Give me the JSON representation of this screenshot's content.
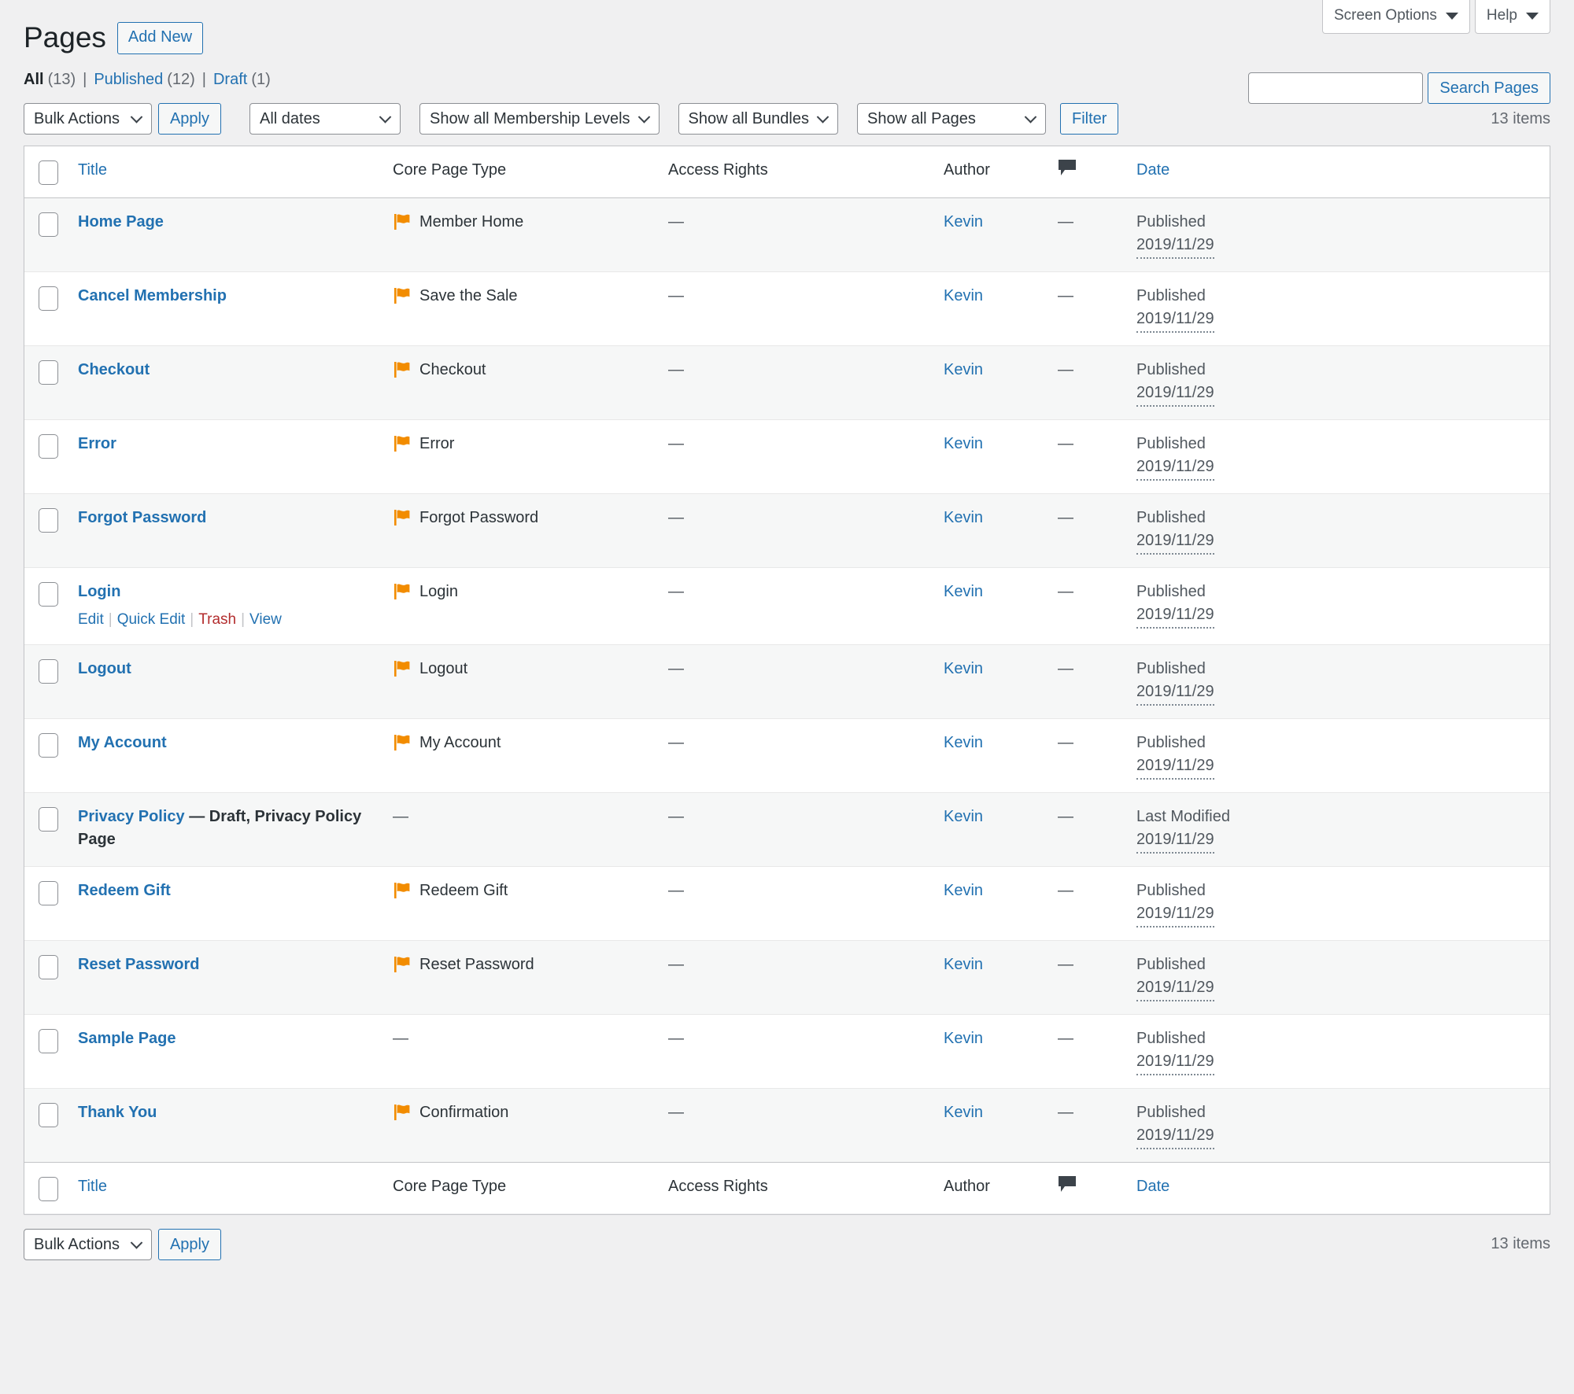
{
  "meta": {
    "screen_options_label": "Screen Options",
    "help_label": "Help"
  },
  "header": {
    "title": "Pages",
    "add_new_label": "Add New"
  },
  "status_links": [
    {
      "label": "All",
      "count": "(13)",
      "current": true
    },
    {
      "label": "Published",
      "count": "(12)",
      "current": false
    },
    {
      "label": "Draft",
      "count": "(1)",
      "current": false
    }
  ],
  "search": {
    "value": "",
    "placeholder": "",
    "submit_label": "Search Pages"
  },
  "tablenav_top": {
    "bulk_actions_label": "Bulk Actions",
    "apply_label": "Apply",
    "dates_label": "All dates",
    "membership_levels_label": "Show all Membership Levels",
    "bundles_label": "Show all Bundles",
    "pages_label": "Show all Pages",
    "filter_label": "Filter",
    "items_count": "13 items"
  },
  "tablenav_bottom": {
    "bulk_actions_label": "Bulk Actions",
    "apply_label": "Apply",
    "items_count": "13 items"
  },
  "columns": {
    "title": "Title",
    "core_page_type": "Core Page Type",
    "access_rights": "Access Rights",
    "author": "Author",
    "comments_icon": "comment-bubble-icon",
    "date": "Date"
  },
  "rows": [
    {
      "title": "Home Page",
      "post_state": "",
      "core_page_type": "Member Home",
      "has_flag": true,
      "access_rights": "—",
      "author": "Kevin",
      "comments": "—",
      "date_status": "Published",
      "date_value": "2019/11/29",
      "actions": []
    },
    {
      "title": "Cancel Membership",
      "post_state": "",
      "core_page_type": "Save the Sale",
      "has_flag": true,
      "access_rights": "—",
      "author": "Kevin",
      "comments": "—",
      "date_status": "Published",
      "date_value": "2019/11/29",
      "actions": []
    },
    {
      "title": "Checkout",
      "post_state": "",
      "core_page_type": "Checkout",
      "has_flag": true,
      "access_rights": "—",
      "author": "Kevin",
      "comments": "—",
      "date_status": "Published",
      "date_value": "2019/11/29",
      "actions": []
    },
    {
      "title": "Error",
      "post_state": "",
      "core_page_type": "Error",
      "has_flag": true,
      "access_rights": "—",
      "author": "Kevin",
      "comments": "—",
      "date_status": "Published",
      "date_value": "2019/11/29",
      "actions": []
    },
    {
      "title": "Forgot Password",
      "post_state": "",
      "core_page_type": "Forgot Password",
      "has_flag": true,
      "access_rights": "—",
      "author": "Kevin",
      "comments": "—",
      "date_status": "Published",
      "date_value": "2019/11/29",
      "actions": []
    },
    {
      "title": "Login",
      "post_state": "",
      "core_page_type": "Login",
      "has_flag": true,
      "access_rights": "—",
      "author": "Kevin",
      "comments": "—",
      "date_status": "Published",
      "date_value": "2019/11/29",
      "actions": [
        "Edit",
        "Quick Edit",
        "Trash",
        "View"
      ]
    },
    {
      "title": "Logout",
      "post_state": "",
      "core_page_type": "Logout",
      "has_flag": true,
      "access_rights": "—",
      "author": "Kevin",
      "comments": "—",
      "date_status": "Published",
      "date_value": "2019/11/29",
      "actions": []
    },
    {
      "title": "My Account",
      "post_state": "",
      "core_page_type": "My Account",
      "has_flag": true,
      "access_rights": "—",
      "author": "Kevin",
      "comments": "—",
      "date_status": "Published",
      "date_value": "2019/11/29",
      "actions": []
    },
    {
      "title": "Privacy Policy",
      "post_state": "— Draft, Privacy Policy Page",
      "core_page_type": "—",
      "has_flag": false,
      "access_rights": "—",
      "author": "Kevin",
      "comments": "—",
      "date_status": "Last Modified",
      "date_value": "2019/11/29",
      "actions": []
    },
    {
      "title": "Redeem Gift",
      "post_state": "",
      "core_page_type": "Redeem Gift",
      "has_flag": true,
      "access_rights": "—",
      "author": "Kevin",
      "comments": "—",
      "date_status": "Published",
      "date_value": "2019/11/29",
      "actions": []
    },
    {
      "title": "Reset Password",
      "post_state": "",
      "core_page_type": "Reset Password",
      "has_flag": true,
      "access_rights": "—",
      "author": "Kevin",
      "comments": "—",
      "date_status": "Published",
      "date_value": "2019/11/29",
      "actions": []
    },
    {
      "title": "Sample Page",
      "post_state": "",
      "core_page_type": "—",
      "has_flag": false,
      "access_rights": "—",
      "author": "Kevin",
      "comments": "—",
      "date_status": "Published",
      "date_value": "2019/11/29",
      "actions": []
    },
    {
      "title": "Thank You",
      "post_state": "",
      "core_page_type": "Confirmation",
      "has_flag": true,
      "access_rights": "—",
      "author": "Kevin",
      "comments": "—",
      "date_status": "Published",
      "date_value": "2019/11/29",
      "actions": []
    }
  ],
  "colors": {
    "link": "#2271b1",
    "flag_orange": "#f28c00",
    "trash_red": "#b32d2e",
    "background": "#f0f0f1",
    "row_alt": "#f6f7f7"
  }
}
